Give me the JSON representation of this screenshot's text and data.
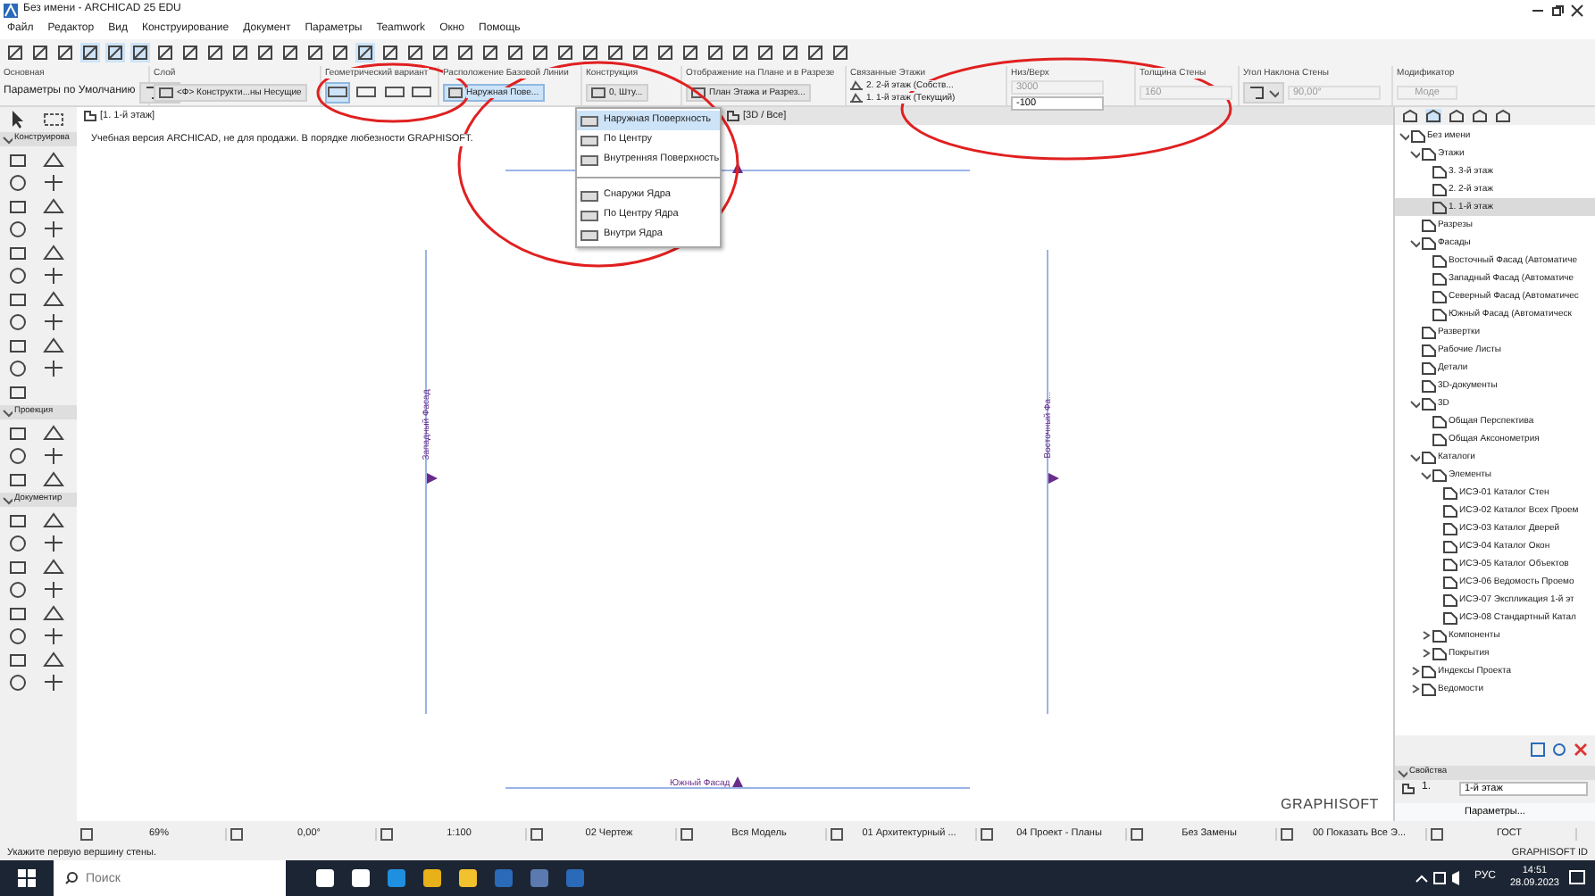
{
  "window": {
    "title": "Без имени - ARCHICAD 25 EDU"
  },
  "menu": [
    "Файл",
    "Редактор",
    "Вид",
    "Конструирование",
    "Документ",
    "Параметры",
    "Teamwork",
    "Окно",
    "Помощь"
  ],
  "infobox": [
    {
      "label": "Основная",
      "controls": [
        {
          "kind": "text",
          "text": "Параметры по Умолчанию"
        },
        {
          "kind": "iconmenu"
        }
      ]
    },
    {
      "label": "Слой",
      "controls": [
        {
          "kind": "dropdown",
          "text": "<Ф> Конструкти...ны Несущие",
          "open": false
        }
      ]
    },
    {
      "label": "Геометрический вариант",
      "controls": [
        {
          "kind": "geom",
          "selected": true
        },
        {
          "kind": "geom",
          "selected": false
        },
        {
          "kind": "geom",
          "selected": false
        },
        {
          "kind": "geom",
          "selected": false
        }
      ]
    },
    {
      "label": "Расположение Базовой Линии",
      "controls": [
        {
          "kind": "dropdown",
          "text": "Наружная Пове...",
          "open": true
        }
      ]
    },
    {
      "label": "Конструкция",
      "controls": [
        {
          "kind": "dropdown",
          "text": "0, Шту...",
          "open": false
        }
      ]
    },
    {
      "label": "Отображение на Плане и в Разрезе",
      "controls": [
        {
          "kind": "dropdown",
          "text": "План Этажа и Разрез...",
          "open": false
        }
      ]
    },
    {
      "label": "Связанные Этажи",
      "controls": [
        {
          "kind": "storey",
          "text": "2. 2-й этаж (Собств..."
        },
        {
          "kind": "storey",
          "text": "1. 1-й этаж (Текущий)"
        }
      ]
    },
    {
      "label": "Низ/Верх",
      "controls": [
        {
          "kind": "field",
          "text": "3000",
          "disabled": true
        },
        {
          "kind": "field",
          "text": "-100",
          "disabled": false
        }
      ]
    },
    {
      "label": "Толщина Стены",
      "controls": [
        {
          "kind": "field",
          "text": "160",
          "disabled": true
        }
      ]
    },
    {
      "label": "Угол Наклона Стены",
      "controls": [
        {
          "kind": "iconmenu"
        },
        {
          "kind": "field",
          "text": "90,00°",
          "disabled": true
        }
      ]
    },
    {
      "label": "Модификатор",
      "controls": [
        {
          "kind": "button",
          "text": "Моде",
          "disabled": true
        }
      ]
    }
  ],
  "baseline_menu": [
    {
      "label": "Наружная Поверхность",
      "selected": true
    },
    {
      "label": "По Центру",
      "selected": false
    },
    {
      "label": "Внутренняя Поверхность",
      "selected": false
    },
    {
      "label": "Снаружи Ядра",
      "selected": false,
      "separator_before": true
    },
    {
      "label": "По Центру Ядра",
      "selected": false
    },
    {
      "label": "Внутри Ядра",
      "selected": false
    }
  ],
  "tabs": [
    {
      "label": "[1. 1-й этаж]",
      "selected": true
    },
    {
      "label": "[3D / Все]",
      "selected": false
    }
  ],
  "toolbox": [
    {
      "label": "Конструирова"
    },
    {
      "label": "Проекция"
    },
    {
      "label": "Документир"
    }
  ],
  "canvas": {
    "notice": "Учебная версия ARCHICAD, не для продажи. В порядке любезности GRAPHISOFT.",
    "logo": "GRAPHISOFT",
    "markers": [
      {
        "kind": "top"
      },
      {
        "kind": "bottom",
        "label": "Южный Фасад"
      },
      {
        "kind": "left",
        "label": "Западный Фасад"
      },
      {
        "kind": "right",
        "label": "Восточный Фа..."
      }
    ]
  },
  "navigator": {
    "tree": [
      {
        "label": "Без имени",
        "expanded": true,
        "selected": false,
        "children": [
          {
            "label": "Этажи",
            "expanded": true,
            "selected": false,
            "children": [
              {
                "label": "3. 3-й этаж",
                "selected": false
              },
              {
                "label": "2. 2-й этаж",
                "selected": false
              },
              {
                "label": "1. 1-й этаж",
                "selected": true
              }
            ]
          },
          {
            "label": "Разрезы",
            "selected": false
          },
          {
            "label": "Фасады",
            "expanded": true,
            "selected": false,
            "children": [
              {
                "label": "Восточный Фасад (Автоматиче",
                "selected": false
              },
              {
                "label": "Западный Фасад (Автоматиче",
                "selected": false
              },
              {
                "label": "Северный Фасад (Автоматичес",
                "selected": false
              },
              {
                "label": "Южный Фасад (Автоматическ",
                "selected": false
              }
            ]
          },
          {
            "label": "Развертки",
            "selected": false
          },
          {
            "label": "Рабочие Листы",
            "selected": false
          },
          {
            "label": "Детали",
            "selected": false
          },
          {
            "label": "3D-документы",
            "selected": false
          },
          {
            "label": "3D",
            "expanded": true,
            "selected": false,
            "children": [
              {
                "label": "Общая Перспектива",
                "selected": false
              },
              {
                "label": "Общая Аксонометрия",
                "selected": false
              }
            ]
          },
          {
            "label": "Каталоги",
            "expanded": true,
            "selected": false,
            "children": [
              {
                "label": "Элементы",
                "expanded": true,
                "selected": false,
                "children": [
                  {
                    "label": "ИСЭ-01 Каталог Стен",
                    "selected": false
                  },
                  {
                    "label": "ИСЭ-02 Каталог Всех Проем",
                    "selected": false
                  },
                  {
                    "label": "ИСЭ-03 Каталог Дверей",
                    "selected": false
                  },
                  {
                    "label": "ИСЭ-04 Каталог Окон",
                    "selected": false
                  },
                  {
                    "label": "ИСЭ-05 Каталог Объектов",
                    "selected": false
                  },
                  {
                    "label": "ИСЭ-06 Ведомость Проемо",
                    "selected": false
                  },
                  {
                    "label": "ИСЭ-07 Экспликация 1-й эт",
                    "selected": false
                  },
                  {
                    "label": "ИСЭ-08 Стандартный Катал",
                    "selected": false
                  }
                ]
              },
              {
                "label": "Компоненты",
                "expanded": false,
                "selected": false
              },
              {
                "label": "Покрытия",
                "expanded": false,
                "selected": false
              }
            ]
          },
          {
            "label": "Индексы Проекта",
            "expanded": false,
            "selected": false
          },
          {
            "label": "Ведомости",
            "expanded": false,
            "selected": false
          }
        ]
      }
    ],
    "properties": {
      "title": "Свойства",
      "number": "1.",
      "name": "1-й этаж",
      "button": "Параметры..."
    }
  },
  "bottom_bar": [
    "69%",
    "0,00°",
    "1:100",
    "02 Чертеж",
    "Вся Модель",
    "01 Архитектурный ...",
    "04 Проект - Планы",
    "Без Замены",
    "00 Показать Все Э...",
    "ГОСТ"
  ],
  "status_bar": {
    "hint": "Укажите первую вершину стены.",
    "brand": "GRAPHISOFT ID"
  },
  "taskbar": {
    "search_placeholder": "Поиск",
    "language": "РУС",
    "time": "14:51",
    "date": "28.09.2023"
  }
}
